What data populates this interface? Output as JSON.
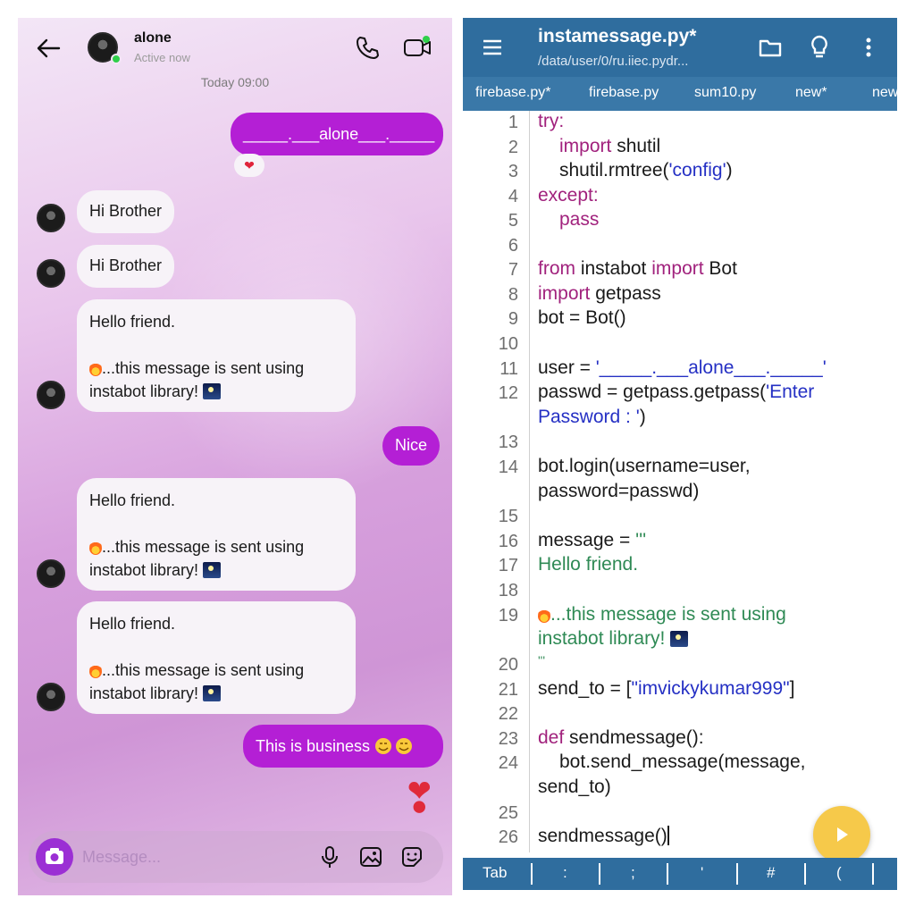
{
  "chat": {
    "contact_name": "alone",
    "contact_status": "Active now",
    "timestamp": "Today 09:00",
    "reaction": "❤",
    "big_heart": "❣",
    "messages": [
      {
        "text": "_____.___alone___._____"
      },
      {
        "text": "Hi Brother"
      },
      {
        "text": "Hi Brother"
      },
      {
        "line1": "Hello friend.",
        "line2": "...this message is sent using",
        "line3": "instabot library!"
      },
      {
        "text": "Nice"
      },
      {
        "line1": "Hello friend.",
        "line2": "...this message is sent using",
        "line3": "instabot library!"
      },
      {
        "line1": "Hello friend.",
        "line2": "...this message is sent using",
        "line3": "instabot library!"
      },
      {
        "text": "This is business"
      }
    ],
    "input_placeholder": "Message..."
  },
  "editor": {
    "title": "instamessage.py*",
    "path": "/data/user/0/ru.iiec.pydr...",
    "tabs": [
      "firebase.py*",
      "firebase.py",
      "sum10.py",
      "new*",
      "new"
    ],
    "line_numbers": [
      "1",
      "2",
      "3",
      "4",
      "5",
      "6",
      "7",
      "8",
      "9",
      "10",
      "11",
      "12",
      "13",
      "14",
      "15",
      "16",
      "17",
      "18",
      "19",
      "20",
      "21",
      "22",
      "23",
      "24",
      "25",
      "26"
    ],
    "code": {
      "l1_kw": "try:",
      "l2_kw": "import",
      "l2_rest": " shutil",
      "l3_a": "shutil.rmtree(",
      "l3_str": "'config'",
      "l3_b": ")",
      "l4_kw": "except:",
      "l5_kw": "pass",
      "l7_kw1": "from",
      "l7_mid": " instabot ",
      "l7_kw2": "import",
      "l7_rest": " Bot",
      "l8_kw": "import",
      "l8_rest": " getpass",
      "l9": "bot = Bot()",
      "l11_a": "user = ",
      "l11_str": "'_____.___alone___._____'",
      "l12_a": "passwd = getpass.getpass(",
      "l12_str": "'Enter",
      "l12b_str": "Password : '",
      "l12b_b": ")",
      "l14": "bot.login(username=user,",
      "l14b": "password=passwd)",
      "l16_a": "message = ",
      "l16_str": "'''",
      "l17": "Hello friend.",
      "l19": "...this message is sent using",
      "l19b": "instabot library!",
      "l20": "'''",
      "l21_a": "send_to = [",
      "l21_str": "\"imvickykumar999\"",
      "l21_b": "]",
      "l23_kw": "def",
      "l23_rest": " sendmessage():",
      "l24": "bot.send_message(message,",
      "l24b": "send_to)",
      "l26_a": "sendmessage",
      "l26_b": "()"
    },
    "keys": [
      "Tab",
      ":",
      ";",
      "'",
      "#",
      "("
    ]
  },
  "colors": {
    "accent_purple": "#b41fd5",
    "editor_bar": "#2f6d9e",
    "keyword": "#a1227d",
    "string": "#2530c4",
    "comment": "#2f8a55",
    "run_button": "#f6c94a"
  }
}
